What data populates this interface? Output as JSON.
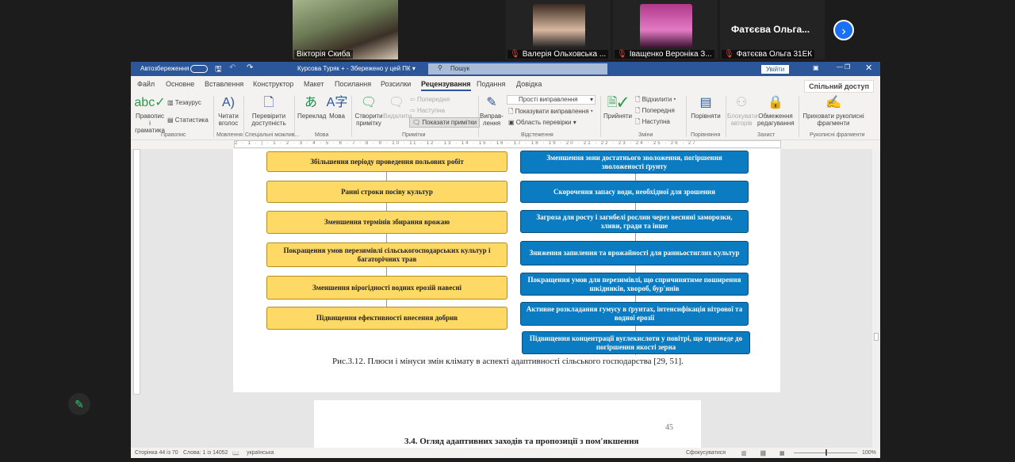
{
  "participants": [
    {
      "name": "Вікторія Скиба",
      "muted": false
    },
    {
      "name": "Валерія Ольховська ...",
      "muted": true
    },
    {
      "name": "Іващенко Вероніка З...",
      "muted": true
    },
    {
      "name": "Фатєєва Ольга 31ЕК",
      "muted": true,
      "display_name": "Фатєєва Ольга..."
    }
  ],
  "word": {
    "autosave": "Автозбереження",
    "doc_title": "Курсова Туряк + - Збережено у цей ПК ▾",
    "search_placeholder": "Пошук",
    "signin": "Увійти",
    "tabs": [
      "Файл",
      "Основне",
      "Вставлення",
      "Конструктор",
      "Макет",
      "Посилання",
      "Розсилки",
      "Рецензування",
      "Подання",
      "Довідка"
    ],
    "active_tab": "Рецензування",
    "share": "Спільний доступ",
    "ribbon": {
      "spelling": "Правопис і граматика",
      "thesaurus": "Тезаурус",
      "stats": "Статистика",
      "read_aloud": "Читати вголос",
      "accessibility": "Перевірити доступність",
      "translate": "Переклад",
      "language": "Мова",
      "new_comment": "Створити примітку",
      "delete": "Видалити",
      "prev_comment": "Попередня",
      "next_comment": "Наступна",
      "show_comments": "Показати примітки",
      "track": "Виправ-лення",
      "markup_select": "Прості виправлення",
      "show_markup": "Показувати виправлення",
      "review_pane": "Область перевірки",
      "accept": "Прийняти",
      "reject": "Відхилити",
      "prev": "Попередня",
      "next": "Наступна",
      "compare": "Порівняти",
      "block_authors": "Блокувати авторів",
      "restrict": "Обмеження редагування",
      "hide_ink": "Приховати рукописні фрагменти",
      "groups": [
        "Правопис",
        "Мовлення",
        "Спеціальні можлив...",
        "Мова",
        "Примітки",
        "Відстеження",
        "Зміни",
        "Порівняння",
        "Захист",
        "Рукописні фрагменти"
      ]
    },
    "ruler": "2 · 1 · | · 1 · 2 · 3 · 4 · 5 · 6 · 7 · 8 · 9 · 10 · 11 · 12 · 13 · 14 · 15 · 16 · 17 · 18 · 19 · 20 · 21 · 22 · 23 · 24 · 25 · 26 · 27",
    "diagram": {
      "left": [
        "Збільшення періоду проведення польових робіт",
        "Ранні строки посіву культур",
        "Зменшення термінів збирання врожаю",
        "Покращення умов перезимівлі сільськогосподарських культур і багаторічних трав",
        "Зменшення вірогідності водних ерозій навесні",
        "Підвищення ефективності внесення добрив"
      ],
      "right": [
        "Зменшення зони достатнього зволоження, погіршення зволоженості ґрунту",
        "Скорочення запасу води, необхідної для зрошення",
        "Загроза для росту і загибелі рослин через весняні заморозки, зливи, гради та інше",
        "Зниження запилення та врожайності для ранньостиглих культур",
        "Покращення умов для перезимівлі, що спричинятиме поширення шкідників, хвороб, бур'янів",
        "Активне розкладання гумусу в ґрунтах, інтенсифікація вітрової та водної ерозії",
        "Підвищення концентрації вуглекислоти у повітрі, що призведе до погіршення якості зерна"
      ],
      "colors": {
        "plus": "#ffd966",
        "minus": "#0b7cc1"
      }
    },
    "caption": "Рис.3.12. Плюси і мінуси змін клімату в аспекті адаптивності сільського господарства [29, 51].",
    "page_number": "45",
    "next_heading": "3.4. Огляд адаптивних заходів та пропозиції з пом'якшення",
    "status": {
      "page": "Сторінка 44 із 70",
      "words": "Слова: 1 із 14052",
      "language": "українська",
      "focus": "Сфокусуватися",
      "zoom": "100%"
    }
  }
}
